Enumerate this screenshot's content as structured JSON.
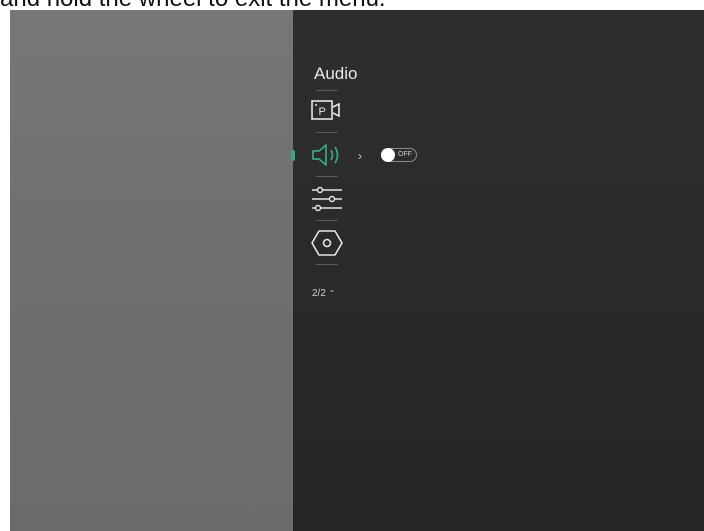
{
  "caption": "and hold the wheel to exit the menu.",
  "menu": {
    "title": "Audio",
    "items": [
      {
        "icon": "picture-in-picture-icon"
      },
      {
        "icon": "speaker-icon",
        "active": true
      },
      {
        "icon": "sliders-icon"
      },
      {
        "icon": "hex-nut-icon"
      }
    ],
    "audio_toggle": {
      "state": "OFF"
    },
    "page_indicator": "2/2"
  },
  "colors": {
    "accent": "#3aa884",
    "panel_left": "#707070",
    "panel_right": "#2a2a2a"
  }
}
